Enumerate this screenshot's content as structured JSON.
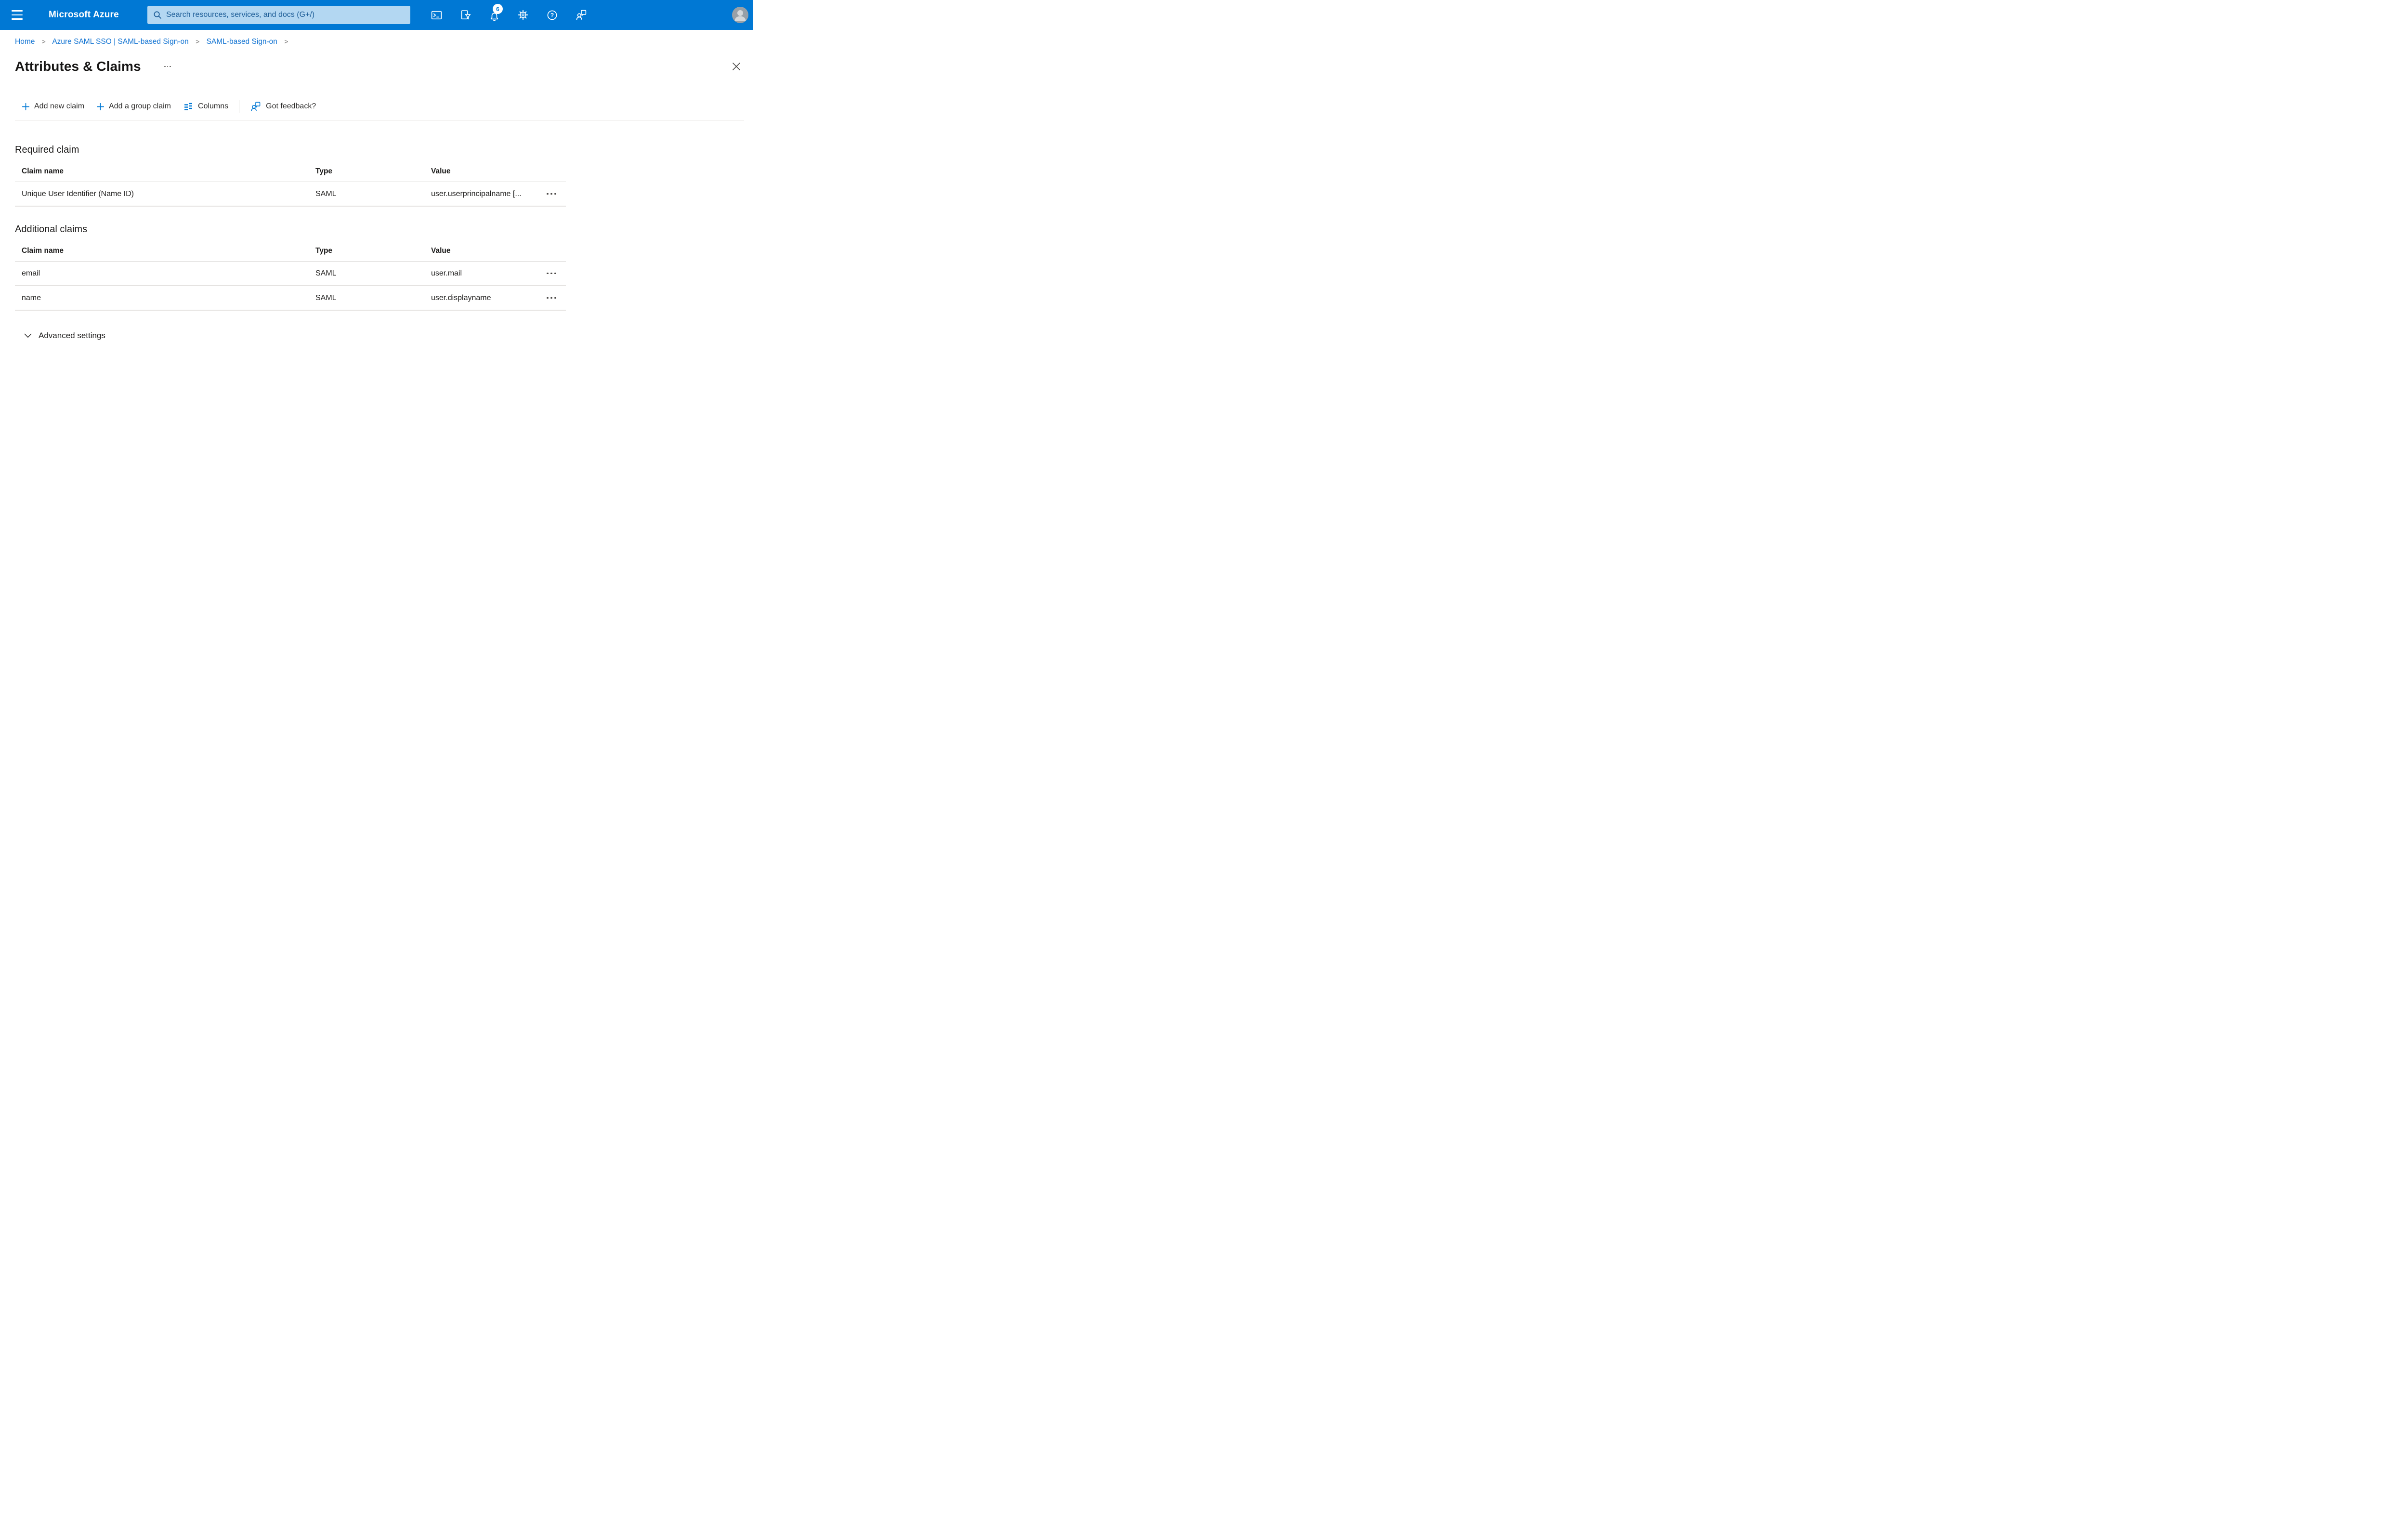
{
  "topbar": {
    "brand": "Microsoft Azure",
    "search": {
      "placeholder": "Search resources, services, and docs (G+/)"
    },
    "notifications_badge": "6"
  },
  "breadcrumb": {
    "separator": ">",
    "items": [
      {
        "label": "Home"
      },
      {
        "label": "Azure SAML SSO | SAML-based Sign-on"
      },
      {
        "label": "SAML-based Sign-on"
      }
    ]
  },
  "page": {
    "title": "Attributes & Claims"
  },
  "toolbar": {
    "add_new_claim": "Add new claim",
    "add_a_group_claim": "Add a group claim",
    "columns": "Columns",
    "got_feedback": "Got feedback?"
  },
  "required_claim": {
    "heading": "Required claim",
    "columns": {
      "claim_name": "Claim name",
      "type": "Type",
      "value": "Value"
    },
    "rows": [
      {
        "claim_name": "Unique User Identifier (Name ID)",
        "type": "SAML",
        "value": "user.userprincipalname [..."
      }
    ]
  },
  "additional_claims": {
    "heading": "Additional claims",
    "columns": {
      "claim_name": "Claim name",
      "type": "Type",
      "value": "Value"
    },
    "rows": [
      {
        "claim_name": "email",
        "type": "SAML",
        "value": "user.mail"
      },
      {
        "claim_name": "name",
        "type": "SAML",
        "value": "user.displayname"
      }
    ]
  },
  "advanced_settings": {
    "label": "Advanced settings"
  },
  "icons": {
    "hamburger": "menu",
    "search": "magnifier",
    "cloud_shell": "terminal",
    "directory_filter": "funnel-document",
    "notifications": "bell",
    "settings": "gear",
    "help": "question-circle",
    "feedback": "person-speech-bubble",
    "columns": "column-lines",
    "add": "plus",
    "row_menu": "ellipsis",
    "advanced_toggle": "chevron-down",
    "close": "x"
  },
  "colors": {
    "topbar_bg": "#0078d4",
    "search_bg": "#b3d7f2",
    "search_text": "#1d5d97",
    "link_blue": "#1173d2",
    "accent_blue": "#0078d4",
    "text_dark": "#1b1a19",
    "row_divider": "#e5e3e1"
  }
}
